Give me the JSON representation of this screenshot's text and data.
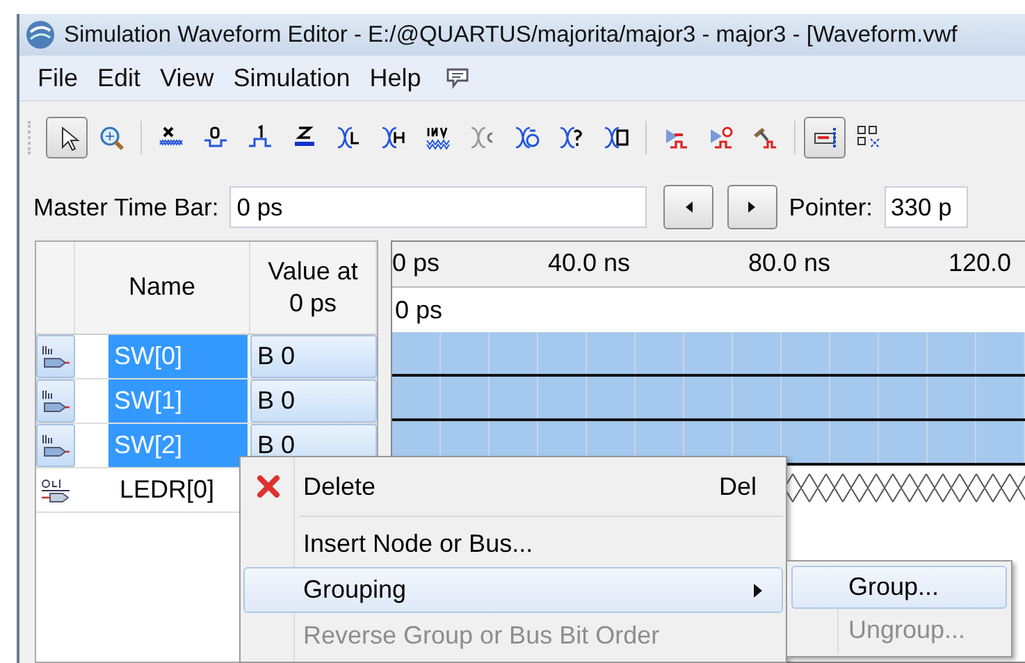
{
  "window": {
    "title": "Simulation Waveform Editor - E:/@QUARTUS/majorita/major3 - major3 - [Waveform.vwf"
  },
  "menu": [
    "File",
    "Edit",
    "View",
    "Simulation",
    "Help"
  ],
  "toolbar": [
    {
      "kind": "select",
      "selected": true
    },
    {
      "kind": "zoom",
      "selected": false
    },
    {
      "kind": "unknown",
      "selected": false
    },
    {
      "kind": "low",
      "selected": false
    },
    {
      "kind": "high",
      "selected": false
    },
    {
      "kind": "highz",
      "selected": false
    },
    {
      "kind": "weak-low",
      "selected": false
    },
    {
      "kind": "weak-high",
      "selected": false
    },
    {
      "kind": "invert",
      "selected": false
    },
    {
      "kind": "count",
      "selected": false
    },
    {
      "kind": "clock",
      "selected": false
    },
    {
      "kind": "random",
      "selected": false
    },
    {
      "kind": "value",
      "selected": false
    },
    {
      "kind": "run",
      "selected": false
    },
    {
      "kind": "run-timing",
      "selected": false
    },
    {
      "kind": "build",
      "selected": false
    },
    {
      "kind": "snap",
      "selected": true
    },
    {
      "kind": "grid",
      "selected": false
    }
  ],
  "time_bar": {
    "label": "Master Time Bar:",
    "value": "0 ps",
    "pointer_label": "Pointer:",
    "pointer_value": "330 p"
  },
  "signals_table": {
    "columns": [
      "Name",
      "Value at\n0 ps"
    ],
    "rows": [
      {
        "kind": "in",
        "name": "SW[0]",
        "value": "B 0",
        "selected": true
      },
      {
        "kind": "in",
        "name": "SW[1]",
        "value": "B 0",
        "selected": true
      },
      {
        "kind": "in",
        "name": "SW[2]",
        "value": "B 0",
        "selected": true
      },
      {
        "kind": "out",
        "name": "LEDR[0]",
        "selected": false
      }
    ]
  },
  "timeline": {
    "ticks": [
      "0 ps",
      "40.0 ns",
      "80.0 ns",
      "120.0"
    ],
    "cursor": "0 ps"
  },
  "context_menu": {
    "items": [
      {
        "kind": "delete",
        "label": "Delete",
        "shortcut": "Del",
        "highlighted": false,
        "disabled": false,
        "submenu": false
      },
      {
        "kind": "separator"
      },
      {
        "kind": "command",
        "label": "Insert Node or Bus...",
        "highlighted": false,
        "disabled": false,
        "submenu": false
      },
      {
        "kind": "command",
        "label": "Grouping",
        "highlighted": true,
        "disabled": false,
        "submenu": true
      },
      {
        "kind": "command",
        "label": "Reverse Group or Bus Bit Order",
        "highlighted": false,
        "disabled": true,
        "submenu": false
      }
    ]
  },
  "submenu": {
    "items": [
      {
        "label": "Group...",
        "highlighted": true,
        "disabled": false
      },
      {
        "label": "Ungroup...",
        "highlighted": false,
        "disabled": true
      }
    ]
  }
}
